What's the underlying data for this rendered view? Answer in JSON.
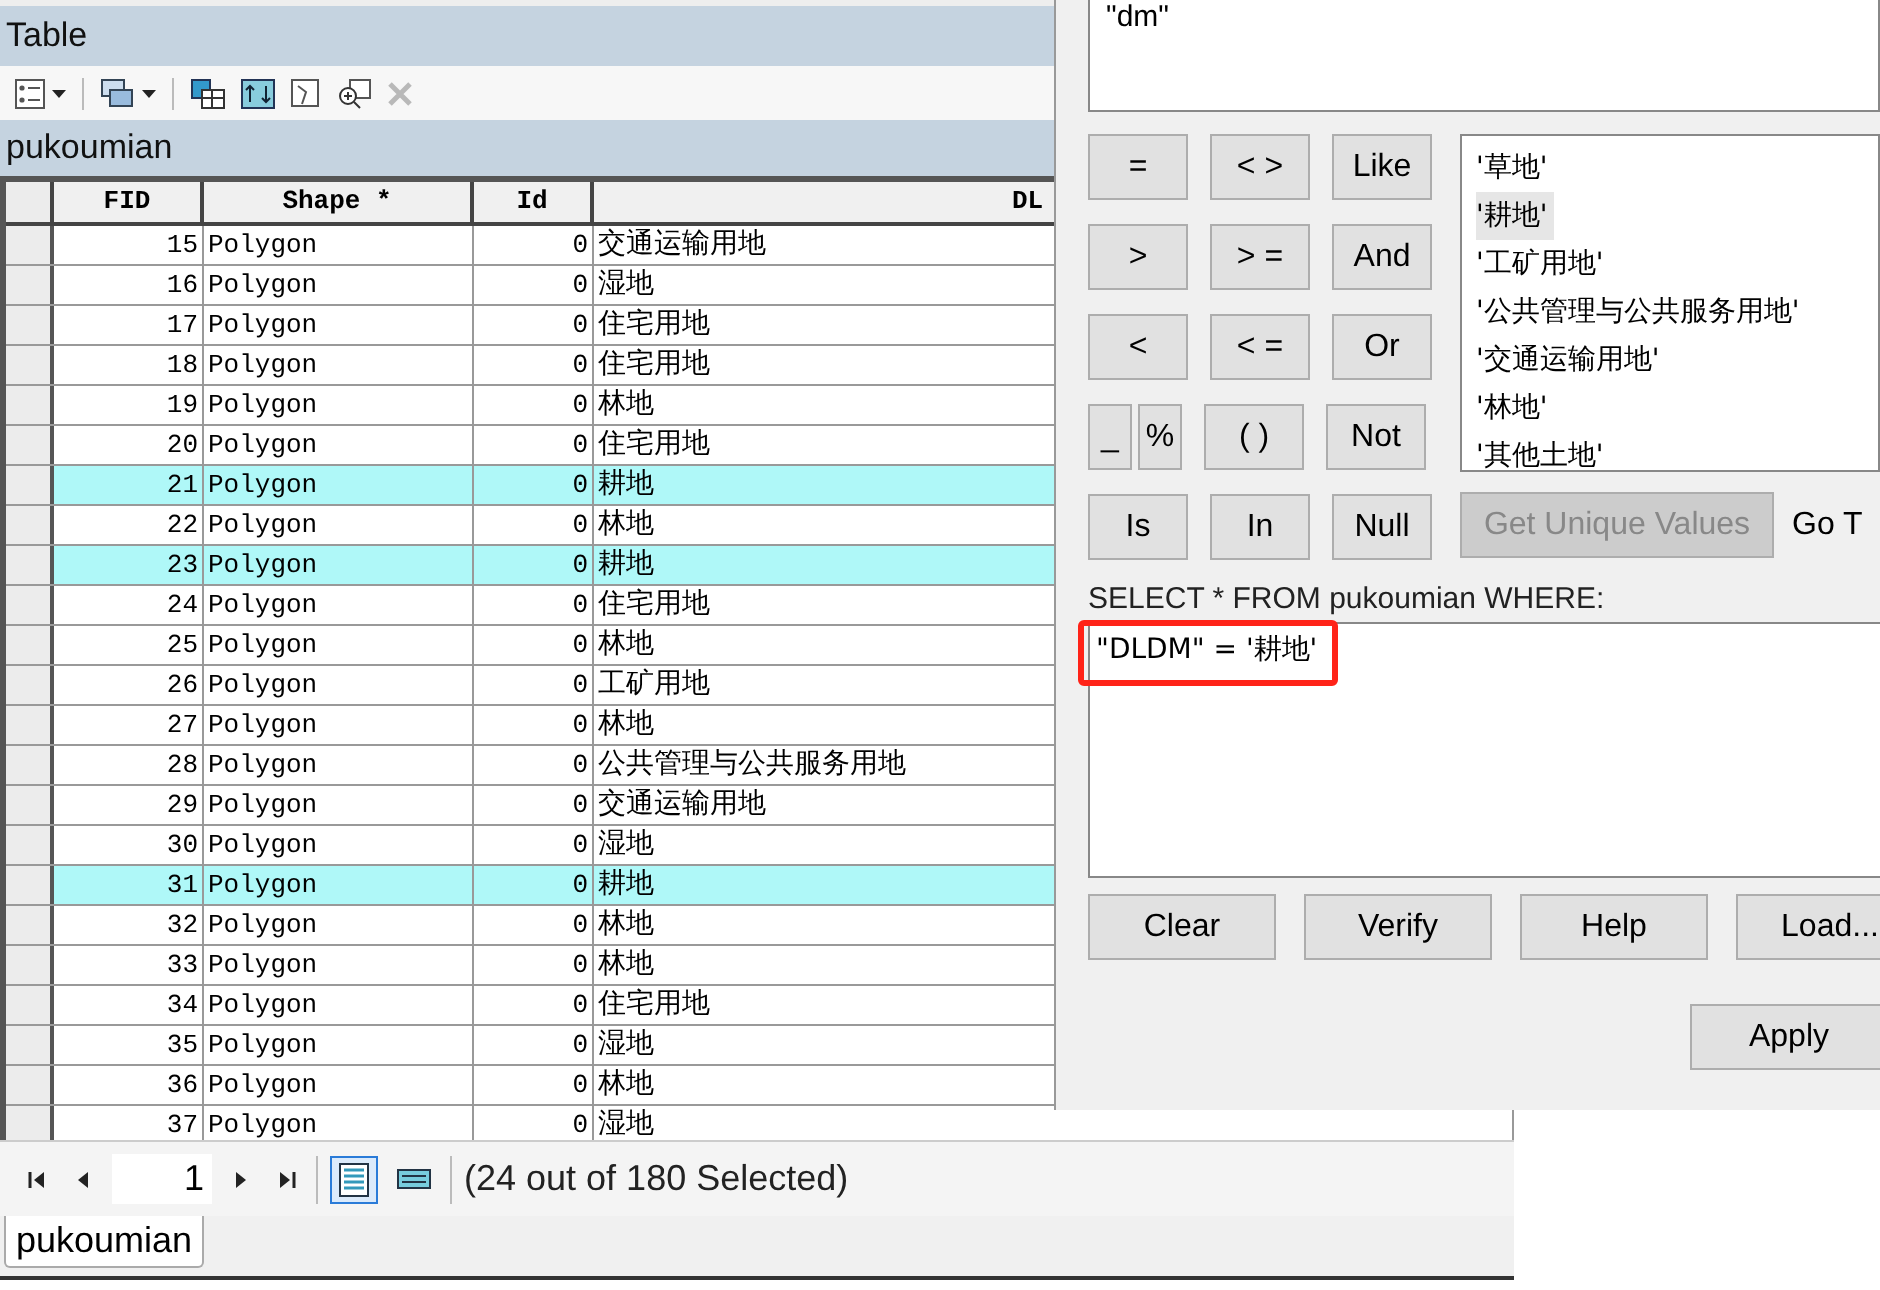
{
  "window": {
    "title": "Table"
  },
  "toolbar": [
    {
      "kind": "options",
      "caret": true,
      "disabled": false
    },
    {
      "kind": "related",
      "caret": true,
      "disabled": false
    },
    {
      "kind": "select-by-attributes",
      "caret": false,
      "disabled": false
    },
    {
      "kind": "switch-selection",
      "caret": false,
      "disabled": false
    },
    {
      "kind": "clear-selection",
      "caret": false,
      "disabled": false
    },
    {
      "kind": "zoom-selected",
      "caret": false,
      "disabled": false
    },
    {
      "kind": "delete",
      "caret": false,
      "disabled": true
    }
  ],
  "layer_title": "pukoumian",
  "table": {
    "columns": [
      "FID",
      "Shape *",
      "Id",
      "DL"
    ],
    "rows": [
      {
        "fid": "15",
        "shape": "Polygon",
        "id": "0",
        "dldm": "交通运输用地",
        "selected": false
      },
      {
        "fid": "16",
        "shape": "Polygon",
        "id": "0",
        "dldm": "湿地",
        "selected": false
      },
      {
        "fid": "17",
        "shape": "Polygon",
        "id": "0",
        "dldm": "住宅用地",
        "selected": false
      },
      {
        "fid": "18",
        "shape": "Polygon",
        "id": "0",
        "dldm": "住宅用地",
        "selected": false
      },
      {
        "fid": "19",
        "shape": "Polygon",
        "id": "0",
        "dldm": "林地",
        "selected": false
      },
      {
        "fid": "20",
        "shape": "Polygon",
        "id": "0",
        "dldm": "住宅用地",
        "selected": false
      },
      {
        "fid": "21",
        "shape": "Polygon",
        "id": "0",
        "dldm": "耕地",
        "selected": true
      },
      {
        "fid": "22",
        "shape": "Polygon",
        "id": "0",
        "dldm": "林地",
        "selected": false
      },
      {
        "fid": "23",
        "shape": "Polygon",
        "id": "0",
        "dldm": "耕地",
        "selected": true
      },
      {
        "fid": "24",
        "shape": "Polygon",
        "id": "0",
        "dldm": "住宅用地",
        "selected": false
      },
      {
        "fid": "25",
        "shape": "Polygon",
        "id": "0",
        "dldm": "林地",
        "selected": false
      },
      {
        "fid": "26",
        "shape": "Polygon",
        "id": "0",
        "dldm": "工矿用地",
        "selected": false
      },
      {
        "fid": "27",
        "shape": "Polygon",
        "id": "0",
        "dldm": "林地",
        "selected": false
      },
      {
        "fid": "28",
        "shape": "Polygon",
        "id": "0",
        "dldm": "公共管理与公共服务用地",
        "selected": false
      },
      {
        "fid": "29",
        "shape": "Polygon",
        "id": "0",
        "dldm": "交通运输用地",
        "selected": false
      },
      {
        "fid": "30",
        "shape": "Polygon",
        "id": "0",
        "dldm": "湿地",
        "selected": false
      },
      {
        "fid": "31",
        "shape": "Polygon",
        "id": "0",
        "dldm": "耕地",
        "selected": true
      },
      {
        "fid": "32",
        "shape": "Polygon",
        "id": "0",
        "dldm": "林地",
        "selected": false
      },
      {
        "fid": "33",
        "shape": "Polygon",
        "id": "0",
        "dldm": "林地",
        "selected": false
      },
      {
        "fid": "34",
        "shape": "Polygon",
        "id": "0",
        "dldm": "住宅用地",
        "selected": false
      },
      {
        "fid": "35",
        "shape": "Polygon",
        "id": "0",
        "dldm": "湿地",
        "selected": false
      },
      {
        "fid": "36",
        "shape": "Polygon",
        "id": "0",
        "dldm": "林地",
        "selected": false
      },
      {
        "fid": "37",
        "shape": "Polygon",
        "id": "0",
        "dldm": "湿地",
        "selected": false
      }
    ]
  },
  "navigation": {
    "page": "1",
    "views": [
      {
        "kind": "all",
        "selected": true
      },
      {
        "kind": "selected",
        "selected": false
      }
    ],
    "status": "(24 out of 180 Selected)"
  },
  "tabs": [
    {
      "label": "pukoumian",
      "selected": true
    }
  ],
  "dialog": {
    "fields": [
      "\"dm\""
    ],
    "operators": [
      [
        {
          "label": "=",
          "kind": "normal"
        },
        {
          "label": "< >",
          "kind": "normal"
        },
        {
          "label": "Like",
          "kind": "normal"
        }
      ],
      [
        {
          "label": ">",
          "kind": "normal"
        },
        {
          "label": "> =",
          "kind": "normal"
        },
        {
          "label": "And",
          "kind": "normal"
        }
      ],
      [
        {
          "label": "<",
          "kind": "normal"
        },
        {
          "label": "< =",
          "kind": "normal"
        },
        {
          "label": "Or",
          "kind": "normal"
        }
      ],
      [
        {
          "label": "_",
          "kind": "narrow"
        },
        {
          "label": "%",
          "kind": "narrow"
        },
        {
          "label": "( )",
          "kind": "normal"
        },
        {
          "label": "Not",
          "kind": "normal"
        }
      ],
      [
        {
          "label": "Is",
          "kind": "normal"
        },
        {
          "label": "In",
          "kind": "normal"
        },
        {
          "label": "Null",
          "kind": "normal"
        }
      ]
    ],
    "values": [
      {
        "label": "'草地'",
        "selected": false
      },
      {
        "label": "'耕地'",
        "selected": true
      },
      {
        "label": "'工矿用地'",
        "selected": false
      },
      {
        "label": "'公共管理与公共服务用地'",
        "selected": false
      },
      {
        "label": "'交通运输用地'",
        "selected": false
      },
      {
        "label": "'林地'",
        "selected": false
      },
      {
        "label": "'其他土地'",
        "selected": false
      }
    ],
    "get_unique_values": {
      "label": "Get Unique Values",
      "disabled": true
    },
    "go_to": "Go T",
    "where_label": "SELECT * FROM pukoumian WHERE:",
    "where_clause": "\"DLDM\" = '耕地'",
    "highlight": true,
    "buttons": [
      "Clear",
      "Verify",
      "Help",
      "Load..."
    ],
    "apply": "Apply"
  }
}
